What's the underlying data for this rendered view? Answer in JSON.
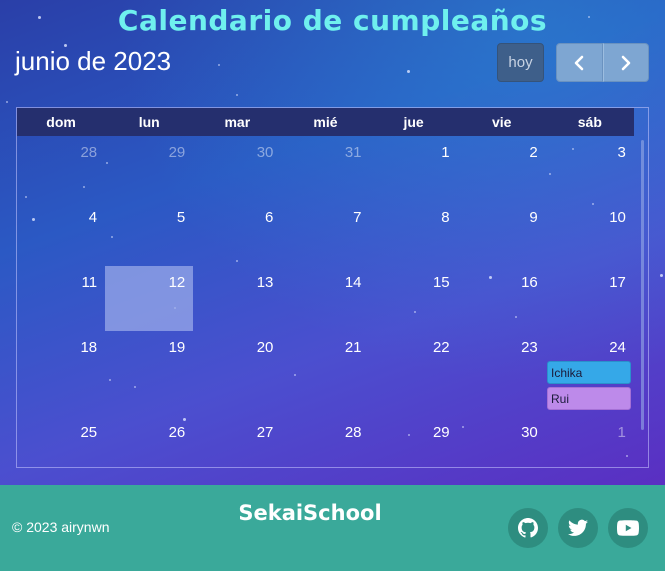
{
  "site": {
    "title": "Calendario de cumpleaños"
  },
  "toolbar": {
    "month_title": "junio de 2023",
    "today_label": "hoy"
  },
  "weekdays": [
    "dom",
    "lun",
    "mar",
    "mié",
    "jue",
    "vie",
    "sáb"
  ],
  "weeks": [
    [
      {
        "n": "28",
        "other": true
      },
      {
        "n": "29",
        "other": true
      },
      {
        "n": "30",
        "other": true
      },
      {
        "n": "31",
        "other": true
      },
      {
        "n": "1"
      },
      {
        "n": "2"
      },
      {
        "n": "3"
      }
    ],
    [
      {
        "n": "4"
      },
      {
        "n": "5"
      },
      {
        "n": "6"
      },
      {
        "n": "7"
      },
      {
        "n": "8"
      },
      {
        "n": "9"
      },
      {
        "n": "10"
      }
    ],
    [
      {
        "n": "11"
      },
      {
        "n": "12",
        "today": true
      },
      {
        "n": "13"
      },
      {
        "n": "14"
      },
      {
        "n": "15"
      },
      {
        "n": "16"
      },
      {
        "n": "17"
      }
    ],
    [
      {
        "n": "18"
      },
      {
        "n": "19"
      },
      {
        "n": "20"
      },
      {
        "n": "21"
      },
      {
        "n": "22"
      },
      {
        "n": "23"
      },
      {
        "n": "24"
      }
    ],
    [
      {
        "n": "25"
      },
      {
        "n": "26"
      },
      {
        "n": "27"
      },
      {
        "n": "28"
      },
      {
        "n": "29"
      },
      {
        "n": "30"
      },
      {
        "n": "1",
        "other": true
      }
    ]
  ],
  "events": [
    {
      "label": "Ichika",
      "day": "24",
      "color": "#35a8e8"
    },
    {
      "label": "Rui",
      "day": "24",
      "color": "#bd8aea"
    }
  ],
  "footer": {
    "copyright": "© 2023 airynwn",
    "brand": "SekaiSchool",
    "social": [
      "github-icon",
      "twitter-icon",
      "youtube-icon"
    ]
  }
}
